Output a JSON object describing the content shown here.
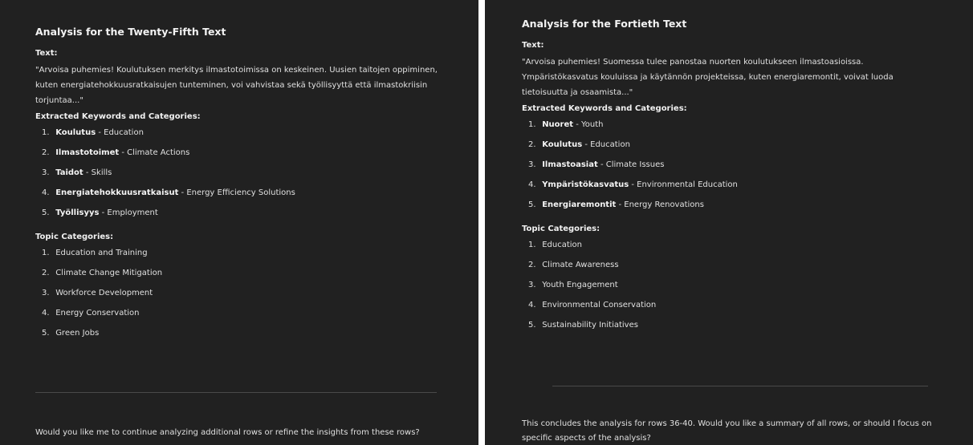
{
  "left": {
    "title": "Analysis for the Twenty-Fifth Text",
    "text_label": "Text:",
    "text": "\"Arvoisa puhemies! Koulutuksen merkitys ilmastotoimissa on keskeinen. Uusien taitojen oppiminen, kuten energiatehokkuusratkaisujen tunteminen, voi vahvistaa sekä työllisyyttä että ilmastokriisin torjuntaa...\"",
    "keywords_label": "Extracted Keywords and Categories:",
    "keywords": [
      {
        "num": "1.",
        "term": "Koulutus",
        "meaning": " - Education"
      },
      {
        "num": "2.",
        "term": "Ilmastotoimet",
        "meaning": " - Climate Actions"
      },
      {
        "num": "3.",
        "term": "Taidot",
        "meaning": " - Skills"
      },
      {
        "num": "4.",
        "term": "Energiatehokkuusratkaisut",
        "meaning": " - Energy Efficiency Solutions"
      },
      {
        "num": "5.",
        "term": "Työllisyys",
        "meaning": " - Employment"
      }
    ],
    "topics_label": "Topic Categories:",
    "topics": [
      {
        "num": "1.",
        "label": "Education and Training"
      },
      {
        "num": "2.",
        "label": "Climate Change Mitigation"
      },
      {
        "num": "3.",
        "label": "Workforce Development"
      },
      {
        "num": "4.",
        "label": "Energy Conservation"
      },
      {
        "num": "5.",
        "label": "Green Jobs"
      }
    ],
    "footer": "Would you like me to continue analyzing additional rows or refine the insights from these rows?"
  },
  "right": {
    "title": "Analysis for the Fortieth Text",
    "text_label": "Text:",
    "text": "\"Arvoisa puhemies! Suomessa tulee panostaa nuorten koulutukseen ilmastoasioissa. Ympäristökasvatus kouluissa ja käytännön projekteissa, kuten energiaremontit, voivat luoda tietoisuutta ja osaamista...\"",
    "keywords_label": "Extracted Keywords and Categories:",
    "keywords": [
      {
        "num": "1.",
        "term": "Nuoret",
        "meaning": " - Youth"
      },
      {
        "num": "2.",
        "term": "Koulutus",
        "meaning": " - Education"
      },
      {
        "num": "3.",
        "term": "Ilmastoasiat",
        "meaning": " - Climate Issues"
      },
      {
        "num": "4.",
        "term": "Ympäristökasvatus",
        "meaning": " - Environmental Education"
      },
      {
        "num": "5.",
        "term": "Energiaremontit",
        "meaning": " - Energy Renovations"
      }
    ],
    "topics_label": "Topic Categories:",
    "topics": [
      {
        "num": "1.",
        "label": "Education"
      },
      {
        "num": "2.",
        "label": "Climate Awareness"
      },
      {
        "num": "3.",
        "label": "Youth Engagement"
      },
      {
        "num": "4.",
        "label": "Environmental Conservation"
      },
      {
        "num": "5.",
        "label": "Sustainability Initiatives"
      }
    ],
    "footer": "This concludes the analysis for rows 36-40. Would you like a summary of all rows, or should I focus on specific aspects of the analysis?"
  }
}
